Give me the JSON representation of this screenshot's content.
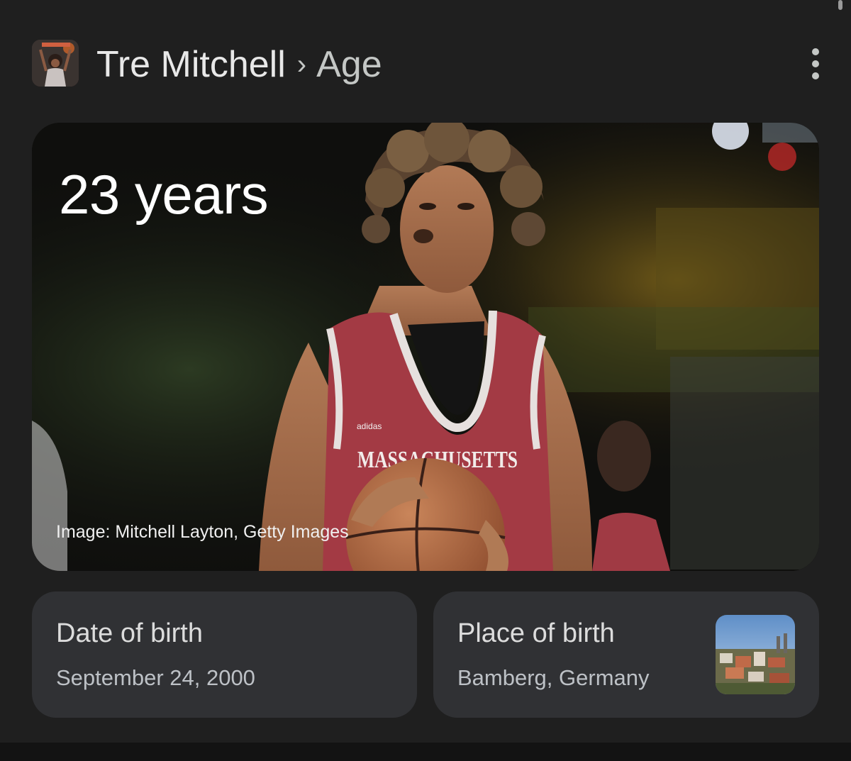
{
  "header": {
    "entity": "Tre Mitchell",
    "separator": "›",
    "attribute": "Age"
  },
  "hero": {
    "age": "23 years",
    "jersey_text": "MASSACHUSETTS",
    "jersey_brand": "adidas",
    "credit": "Image: Mitchell Layton, Getty Images"
  },
  "cards": {
    "dob": {
      "label": "Date of birth",
      "value": "September 24, 2000"
    },
    "pob": {
      "label": "Place of birth",
      "value": "Bamberg, Germany"
    }
  },
  "colors": {
    "background": "#1f1f1f",
    "card": "#303134",
    "jersey": "#a33a44"
  }
}
